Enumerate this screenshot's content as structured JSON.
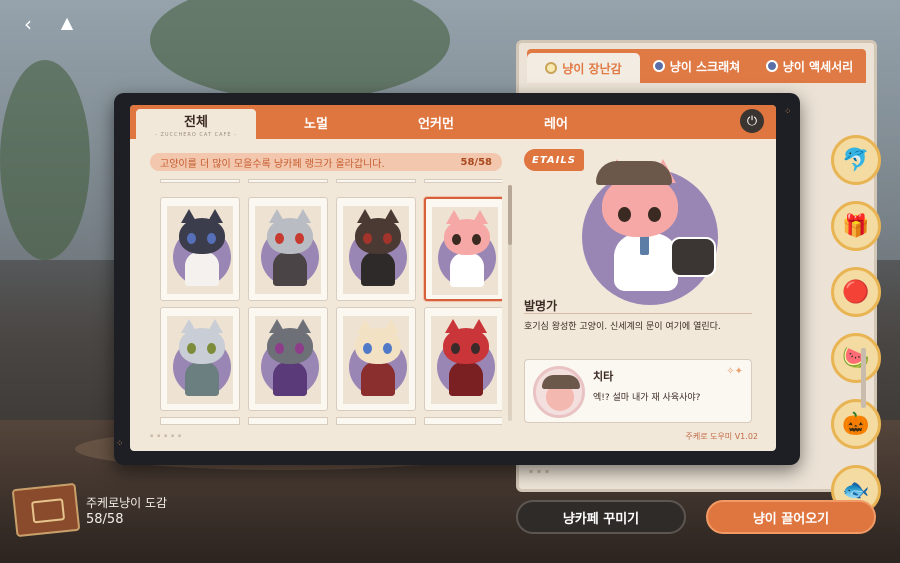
{
  "colors": {
    "accent": "#e0763f",
    "panel": "#f1e8da",
    "card_circle": "#9a86b4"
  },
  "top_bar": {
    "back_icon": "chevron-left-icon",
    "home_icon": "home-icon"
  },
  "main_tabs": [
    {
      "label": "전체",
      "sub": "- ZUCCHERO CAT CAFE -"
    },
    {
      "label": "노멀"
    },
    {
      "label": "언커먼"
    },
    {
      "label": "레어"
    }
  ],
  "notice": {
    "text": "고양이를 더 많이 모을수록 냥카페 랭크가 올라갑니다.",
    "count": "58/58"
  },
  "cards": [
    {
      "fur": "#3c3d4c",
      "eye": "#5570b8",
      "body": "#f4f1ee"
    },
    {
      "fur": "#b9bcc3",
      "eye": "#c63a30",
      "body": "#4a4447"
    },
    {
      "fur": "#4b3a33",
      "eye": "#a3342b",
      "body": "#2f2a2a"
    },
    {
      "fur": "#f6a8a6",
      "eye": "#3b2a22",
      "body": "#ffffff"
    },
    {
      "fur": "#c9ced6",
      "eye": "#7d8c3a",
      "body": "#6b7f80"
    },
    {
      "fur": "#6e7078",
      "eye": "#8d3d8a",
      "body": "#5b3a7a"
    },
    {
      "fur": "#f3e1c4",
      "eye": "#5079c8",
      "body": "#8a2e2e"
    },
    {
      "fur": "#c93538",
      "eye": "#3a2a2a",
      "body": "#7a2023"
    }
  ],
  "footer": {
    "version": "주케로 도우미 V1.02"
  },
  "details": {
    "logo": "ETAILS",
    "name": "발명가",
    "description": "호기심 왕성한 고양이. 신세계의 문이 여기에 열린다.",
    "speaker": "치타",
    "line": "엑!? 설마 내가 재 사육사야?"
  },
  "side_panel": {
    "tabs": [
      "냥이 장난감",
      "냥이 스크래쳐",
      "냥이 액세서리"
    ],
    "items": [
      "dolphin-toy-icon",
      "gift-box-icon",
      "ball-icon",
      "watermelon-icon",
      "pumpkin-icon",
      "fish-toy-icon"
    ]
  },
  "buttons": {
    "decorate": "냥카페 꾸미기",
    "bring": "냥이 끌어오기"
  },
  "book": {
    "title": "주케로냥이 도감",
    "count": "58/58"
  }
}
